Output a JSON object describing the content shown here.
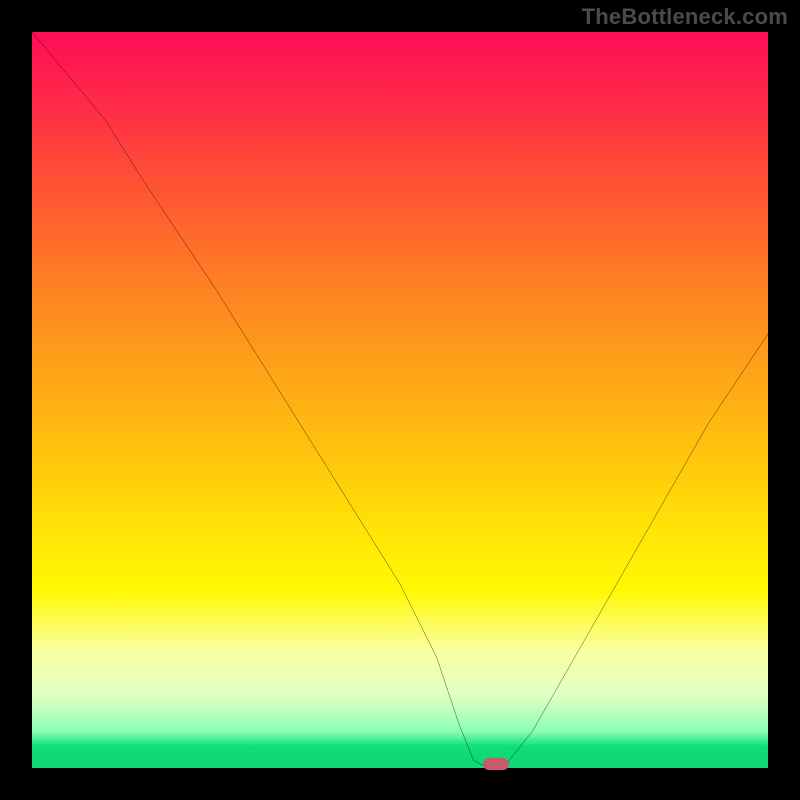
{
  "watermark": "TheBottleneck.com",
  "chart_data": {
    "type": "line",
    "title": "",
    "xlabel": "",
    "ylabel": "",
    "xlim": [
      0,
      100
    ],
    "ylim": [
      0,
      100
    ],
    "grid": false,
    "series": [
      {
        "name": "bottleneck-curve",
        "x": [
          0,
          5,
          10,
          15,
          20,
          25,
          30,
          35,
          40,
          45,
          50,
          55,
          58,
          60,
          62,
          64,
          68,
          72,
          76,
          80,
          84,
          88,
          92,
          96,
          100
        ],
        "y": [
          100,
          94,
          88,
          80,
          72.5,
          65,
          57,
          49,
          41,
          33,
          25,
          15,
          6,
          1,
          0,
          0,
          5,
          12,
          19,
          26,
          33,
          40,
          47,
          53,
          59
        ]
      }
    ],
    "marker": {
      "x": 63,
      "y": 0,
      "shape": "pill",
      "color": "#c9596c"
    },
    "background_gradient": {
      "direction": "vertical",
      "stops": [
        {
          "pos": 0,
          "color": "#ff0d56"
        },
        {
          "pos": 32,
          "color": "#ff7826"
        },
        {
          "pos": 58,
          "color": "#ffc60c"
        },
        {
          "pos": 76,
          "color": "#fff905"
        },
        {
          "pos": 90,
          "color": "#e3ffc3"
        },
        {
          "pos": 97,
          "color": "#12e07a"
        },
        {
          "pos": 100,
          "color": "#0fd977"
        }
      ]
    }
  }
}
